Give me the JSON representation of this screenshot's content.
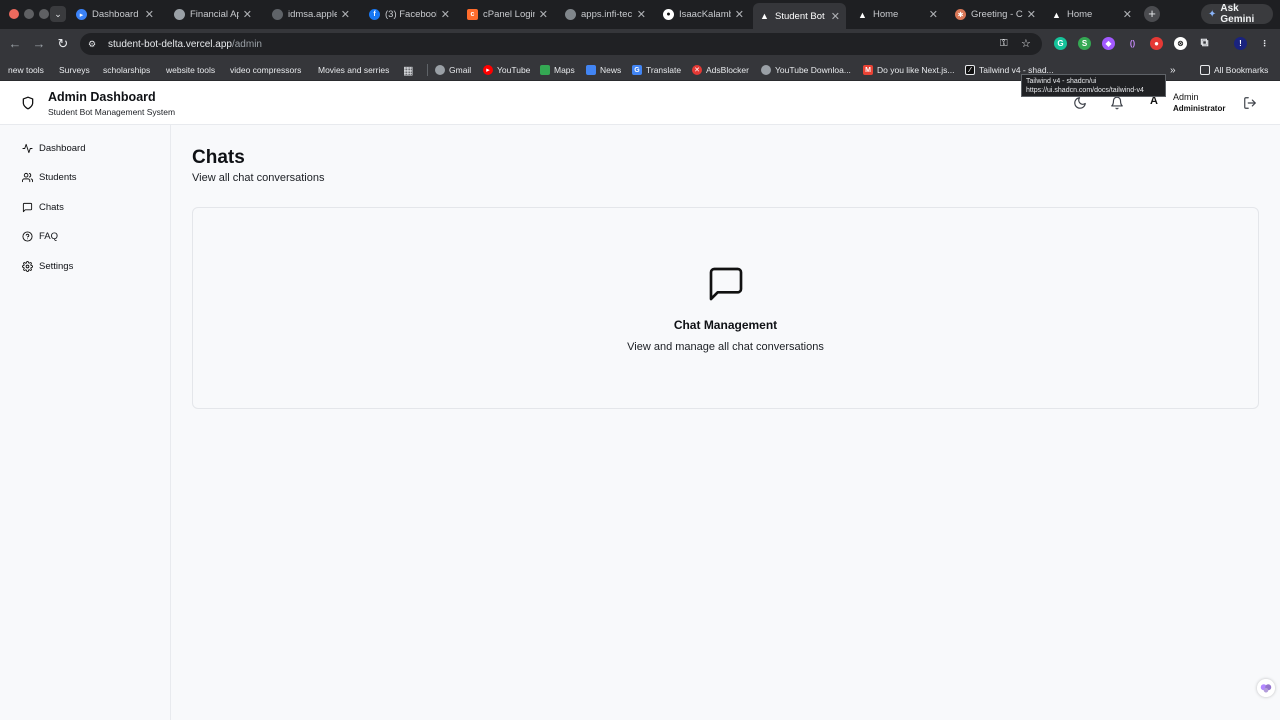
{
  "browser": {
    "tabs": [
      {
        "label": "Dashboard | ",
        "icon": "vscode-icon",
        "color": "#3b82f6",
        "close": "✕"
      },
      {
        "label": "Financial App",
        "icon": "globe-icon",
        "color": "#9aa0a6",
        "close": "✕"
      },
      {
        "label": "idmsa.apple.",
        "icon": "apple-icon",
        "color": "#9aa0a6",
        "close": "✕"
      },
      {
        "label": "(3) Facebook",
        "icon": "facebook-icon",
        "color": "#1877f2",
        "close": "✕"
      },
      {
        "label": "cPanel Login",
        "icon": "cpanel-icon",
        "color": "#ff6c2c",
        "close": "✕"
      },
      {
        "label": "apps.infi-tec",
        "icon": "globe-icon",
        "color": "#9aa0a6",
        "close": "✕"
      },
      {
        "label": "IsaacKalamb",
        "icon": "github-icon",
        "color": "#ffffff",
        "close": "✕"
      },
      {
        "label": "Student Bot",
        "icon": "vercel-icon",
        "color": "#ffffff",
        "close": "✕"
      },
      {
        "label": "Home",
        "icon": "vercel-icon",
        "color": "#ffffff",
        "close": "✕"
      },
      {
        "label": "Greeting - Cl",
        "icon": "claude-icon",
        "color": "#d97757",
        "close": "✕"
      },
      {
        "label": "Home",
        "icon": "vercel-icon",
        "color": "#ffffff",
        "close": "✕"
      }
    ],
    "active_tab_index": 7,
    "ask_gemini": "Ask Gemini",
    "url_host": "student-bot-delta.vercel.app",
    "url_path": "/admin",
    "bookmarks": [
      {
        "label": "new tools"
      },
      {
        "label": "Surveys"
      },
      {
        "label": "scholarships"
      },
      {
        "label": "website tools"
      },
      {
        "label": "video compressors"
      },
      {
        "label": "Movies and serries"
      }
    ],
    "bookmarks_links": [
      {
        "label": "Gmail",
        "icon": "globe-icon",
        "color": "#9aa0a6"
      },
      {
        "label": "YouTube",
        "icon": "youtube-icon",
        "color": "#ff0000"
      },
      {
        "label": "Maps",
        "icon": "maps-icon",
        "color": "#34a853"
      },
      {
        "label": "News",
        "icon": "news-icon",
        "color": "#4285f4"
      },
      {
        "label": "Translate",
        "icon": "translate-icon",
        "color": "#4285f4"
      },
      {
        "label": "AdsBlocker",
        "icon": "adblock-icon",
        "color": "#e53935"
      },
      {
        "label": "YouTube Downloa...",
        "icon": "globe-icon",
        "color": "#9aa0a6"
      },
      {
        "label": "Do you like Next.js...",
        "icon": "gmail-icon",
        "color": "#ea4335"
      },
      {
        "label": "Tailwind v4 - shad...",
        "icon": "shadcn-icon",
        "color": "#111111"
      }
    ],
    "all_bookmarks": "All Bookmarks",
    "tooltip": {
      "title": "Tailwind v4 - shadcn/ui",
      "url": "https://ui.shadcn.com/docs/tailwind-v4"
    }
  },
  "header": {
    "title": "Admin Dashboard",
    "subtitle": "Student Bot Management System",
    "avatar_letter": "A",
    "user_name": "Admin",
    "user_role": "Administrator"
  },
  "sidebar": {
    "items": [
      {
        "label": "Dashboard",
        "icon": "activity-icon"
      },
      {
        "label": "Students",
        "icon": "users-icon"
      },
      {
        "label": "Chats",
        "icon": "message-square-icon"
      },
      {
        "label": "FAQ",
        "icon": "help-circle-icon"
      },
      {
        "label": "Settings",
        "icon": "settings-icon"
      }
    ]
  },
  "main": {
    "title": "Chats",
    "subtitle": "View all chat conversations",
    "card": {
      "icon": "message-square-icon",
      "title": "Chat Management",
      "description": "View and manage all chat conversations"
    }
  }
}
